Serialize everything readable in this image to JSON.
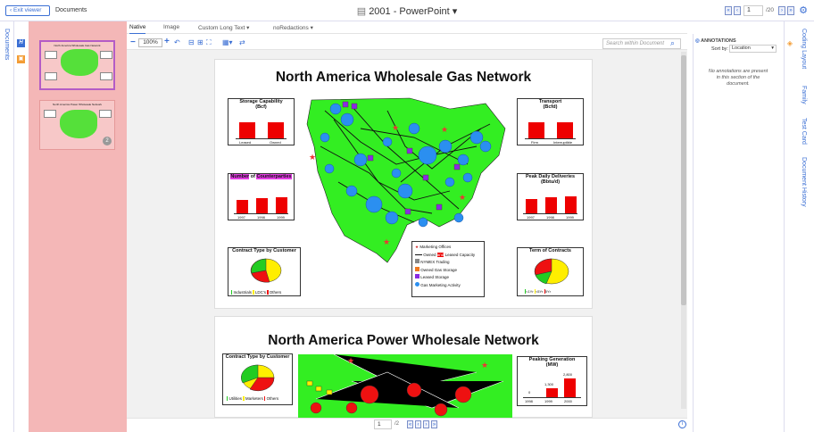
{
  "header": {
    "exit_label": "Exit viewer",
    "documents_label": "Documents",
    "title": "2001 - PowerPoint",
    "page_current": "1",
    "page_total": "/20"
  },
  "left_rail": {
    "documents_tab": "Documents"
  },
  "tabs": [
    {
      "label": "Native"
    },
    {
      "label": "Image"
    },
    {
      "label": "Custom Long Text"
    },
    {
      "label": "noRedactions"
    }
  ],
  "toolbar": {
    "zoom": "100%",
    "search_placeholder": "Search within Document"
  },
  "slides": [
    {
      "title": "North America Wholesale Gas Network",
      "storage": {
        "title": "Storage Capability",
        "unit": "(Bcf)",
        "labels": [
          "Leased",
          "Owned"
        ],
        "values": [
          1,
          1
        ]
      },
      "transport": {
        "title": "Transport",
        "unit": "(Bcfd)",
        "labels": [
          "Firm",
          "Interruptible"
        ],
        "values": [
          1,
          1
        ]
      },
      "counterparties": {
        "title_a": "Number",
        "title_b": " of ",
        "title_c": "Counterparties",
        "labels": [
          "1997",
          "1998",
          "1999"
        ]
      },
      "peak": {
        "title": "Peak Daily Deliveries",
        "unit": "(Bbtu/d)",
        "labels": [
          "1997",
          "1998",
          "1999"
        ]
      },
      "contract": {
        "title": "Contract Type by Customer",
        "legend": [
          "Industrials",
          "LDC's",
          "Others"
        ]
      },
      "term": {
        "title": "Term of Contracts",
        "legend": [
          "<1Yr",
          "<5Yr",
          "5Yr"
        ]
      },
      "legend": [
        "Marketing Offices",
        "Owned",
        "Leased Capacity",
        "NYMEX Trading",
        "Owned Gas Storage",
        "Leased Storage",
        "Gas Marketing Activity"
      ],
      "legend_and": "and"
    },
    {
      "title": "North America Power Wholesale Network",
      "contract": {
        "title": "Contract Type by Customer",
        "legend": [
          "Utilities",
          "Marketers",
          "Others"
        ]
      },
      "peaking": {
        "title": "Peaking Generation",
        "unit": "(MW)",
        "labels": [
          "1998",
          "1999",
          "2000"
        ],
        "values": [
          "0",
          "1,300",
          "2,800"
        ]
      }
    }
  ],
  "thumbnails": [
    {
      "title": "North America Wholesale Gas Network",
      "badge": ""
    },
    {
      "title": "North America Power Wholesale Network",
      "badge": "2"
    }
  ],
  "bottom": {
    "page": "1",
    "total": "/2"
  },
  "annotations": {
    "heading": "ANNOTATIONS",
    "sort_label": "Sort by:",
    "sort_value": "Location",
    "empty": "No annotations are present in this section of the document."
  },
  "right_rail": [
    "Coding Layout",
    "Family",
    "Test Card",
    "Document History"
  ],
  "colors": {
    "accent": "#3b6fd4",
    "thumb_pane": "#f4b7b7",
    "map_green": "#33ee22",
    "bar_red": "#ee0000"
  }
}
